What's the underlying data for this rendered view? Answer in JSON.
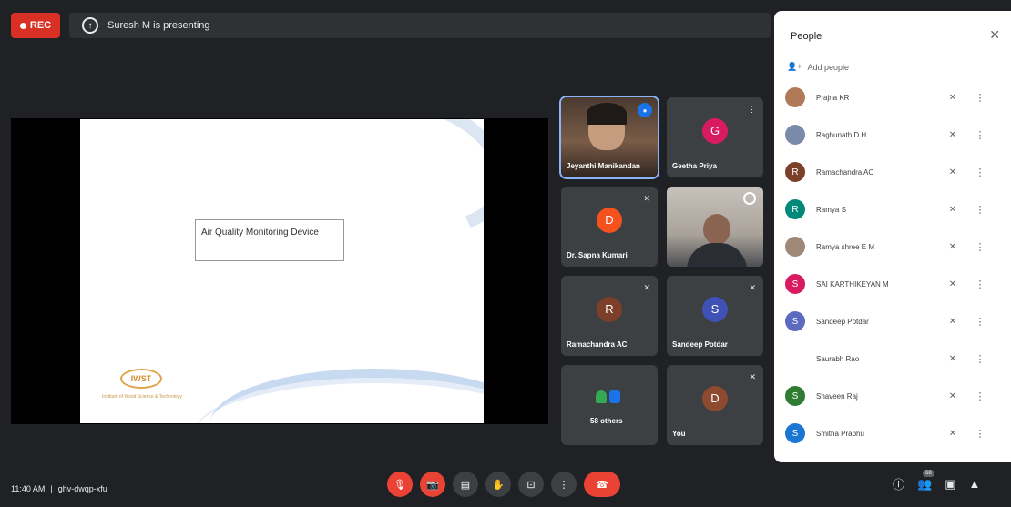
{
  "top": {
    "rec_label": "REC",
    "presenting_label": "Suresh M is presenting"
  },
  "slide": {
    "title_text": "Air Quality Monitoring Device",
    "logo_text": "IWST",
    "logo_caption": "Institute of Wood Science & Technology"
  },
  "tiles": [
    {
      "name": "Jeyanthi Manikandan",
      "initial": "",
      "color": "#5f4b3a"
    },
    {
      "name": "Geetha Priya",
      "initial": "G",
      "color": "#d81b60"
    },
    {
      "name": "Dr. Sapna Kumari",
      "initial": "D",
      "color": "#f4511e"
    },
    {
      "name": "",
      "initial": "",
      "color": "#6d5b4d"
    },
    {
      "name": "Ramachandra AC",
      "initial": "R",
      "color": "#7b3f2a"
    },
    {
      "name": "Sandeep Potdar",
      "initial": "S",
      "color": "#3f51b5"
    },
    {
      "name": "58 others",
      "initial": "",
      "color": "#3c4043"
    },
    {
      "name": "You",
      "initial": "D",
      "color": "#8d4a2f"
    }
  ],
  "people": {
    "title": "People",
    "add_label": "Add people",
    "list": [
      {
        "name": "Prajna KR",
        "initial": "",
        "color": "#b07a58"
      },
      {
        "name": "Raghunath D H",
        "initial": "",
        "color": "#7a8aa8"
      },
      {
        "name": "Ramachandra AC",
        "initial": "R",
        "color": "#7b3f2a"
      },
      {
        "name": "Ramya S",
        "initial": "R",
        "color": "#00897b"
      },
      {
        "name": "Ramya shree E M",
        "initial": "",
        "color": "#a08878"
      },
      {
        "name": "SAI KARTHIKEYAN M",
        "initial": "S",
        "color": "#d81b60"
      },
      {
        "name": "Sandeep Potdar",
        "initial": "S",
        "color": "#5c6bc0"
      },
      {
        "name": "Saurabh Rao",
        "initial": "",
        "color": "#ffffff"
      },
      {
        "name": "Shaveen Raj",
        "initial": "S",
        "color": "#2e7d32"
      },
      {
        "name": "Smitha Prabhu",
        "initial": "S",
        "color": "#1976d2"
      }
    ]
  },
  "bottom": {
    "time": "11:40 AM",
    "separator": "|",
    "meeting_code": "ghv-dwqp-xfu",
    "participant_count": "68"
  }
}
